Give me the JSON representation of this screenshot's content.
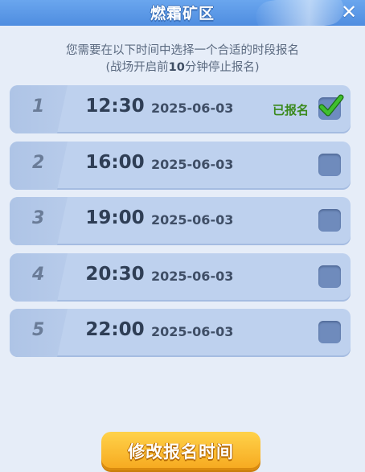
{
  "dialog": {
    "title": "燃霜矿区",
    "close_label": "✕"
  },
  "info": {
    "line1": "您需要在以下时间中选择一个合适的时段报名",
    "line2_prefix": "(战场开启前",
    "line2_bold": "10",
    "line2_suffix": "分钟停止报名)"
  },
  "slots": [
    {
      "index": "1",
      "time": "12:30",
      "date": "2025-06-03",
      "status": "已报名",
      "checked": true
    },
    {
      "index": "2",
      "time": "16:00",
      "date": "2025-06-03",
      "status": "",
      "checked": false
    },
    {
      "index": "3",
      "time": "19:00",
      "date": "2025-06-03",
      "status": "",
      "checked": false
    },
    {
      "index": "4",
      "time": "20:30",
      "date": "2025-06-03",
      "status": "",
      "checked": false
    },
    {
      "index": "5",
      "time": "22:00",
      "date": "2025-06-03",
      "status": "",
      "checked": false
    }
  ],
  "button": {
    "label": "修改报名时间"
  },
  "colors": {
    "header": "#5b97e6",
    "row_bg": "#bed1ee",
    "status_green": "#3b8a1e",
    "check_green": "#2e9a23",
    "button_orange": "#f6a81e"
  }
}
